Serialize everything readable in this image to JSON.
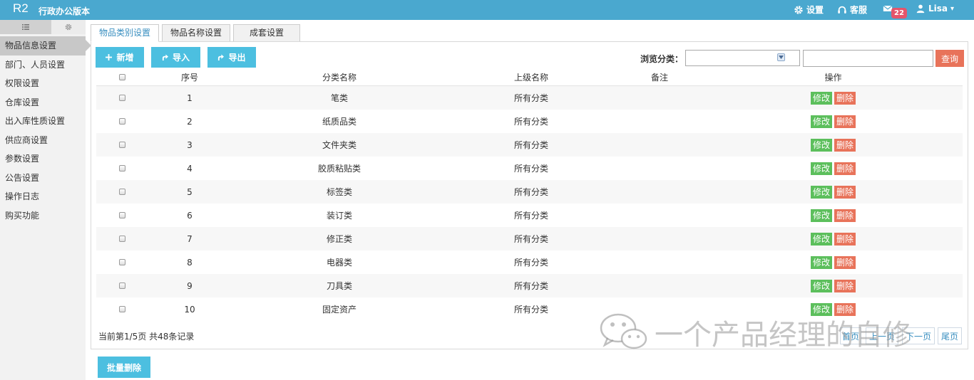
{
  "header": {
    "logo": "R2",
    "app_name": "行政办公版本",
    "settings_label": "设置",
    "support_label": "客服",
    "mail_badge": "22",
    "user_name": "Lisa",
    "user_caret": "▾"
  },
  "sidebar": {
    "items": [
      {
        "label": "物品信息设置"
      },
      {
        "label": "部门、人员设置"
      },
      {
        "label": "权限设置"
      },
      {
        "label": "仓库设置"
      },
      {
        "label": "出入库性质设置"
      },
      {
        "label": "供应商设置"
      },
      {
        "label": "参数设置"
      },
      {
        "label": "公告设置"
      },
      {
        "label": "操作日志"
      },
      {
        "label": "购买功能"
      }
    ]
  },
  "tabs": [
    {
      "label": "物品类别设置"
    },
    {
      "label": "物品名称设置"
    },
    {
      "label": "成套设置"
    }
  ],
  "toolbar": {
    "add_label": "新增",
    "import_label": "导入",
    "export_label": "导出",
    "browse_label": "浏览分类：",
    "search_value": "",
    "query_label": "查询"
  },
  "table": {
    "headers": {
      "seq": "序号",
      "name": "分类名称",
      "parent": "上级名称",
      "remark": "备注",
      "ops": "操作"
    },
    "rows": [
      {
        "seq": "1",
        "name": "笔类",
        "parent": "所有分类",
        "remark": ""
      },
      {
        "seq": "2",
        "name": "纸质品类",
        "parent": "所有分类",
        "remark": ""
      },
      {
        "seq": "3",
        "name": "文件夹类",
        "parent": "所有分类",
        "remark": ""
      },
      {
        "seq": "4",
        "name": "胶质粘贴类",
        "parent": "所有分类",
        "remark": ""
      },
      {
        "seq": "5",
        "name": "标签类",
        "parent": "所有分类",
        "remark": ""
      },
      {
        "seq": "6",
        "name": "装订类",
        "parent": "所有分类",
        "remark": ""
      },
      {
        "seq": "7",
        "name": "修正类",
        "parent": "所有分类",
        "remark": ""
      },
      {
        "seq": "8",
        "name": "电器类",
        "parent": "所有分类",
        "remark": ""
      },
      {
        "seq": "9",
        "name": "刀具类",
        "parent": "所有分类",
        "remark": ""
      },
      {
        "seq": "10",
        "name": "固定资产",
        "parent": "所有分类",
        "remark": ""
      }
    ],
    "edit_label": "修改",
    "delete_label": "删除"
  },
  "pagination": {
    "info": "当前第1/5页 共48条记录",
    "first": "首页",
    "prev": "上一页",
    "next": "下一页",
    "last": "尾页"
  },
  "watermark": "一个产品经理的自修",
  "batch_delete_label": "批量删除",
  "colors": {
    "topbar": "#4aa8cf",
    "primary_button": "#4cbfe0",
    "edit_button": "#5cbf5c",
    "delete_button": "#e8735a",
    "badge": "#e4556b"
  }
}
